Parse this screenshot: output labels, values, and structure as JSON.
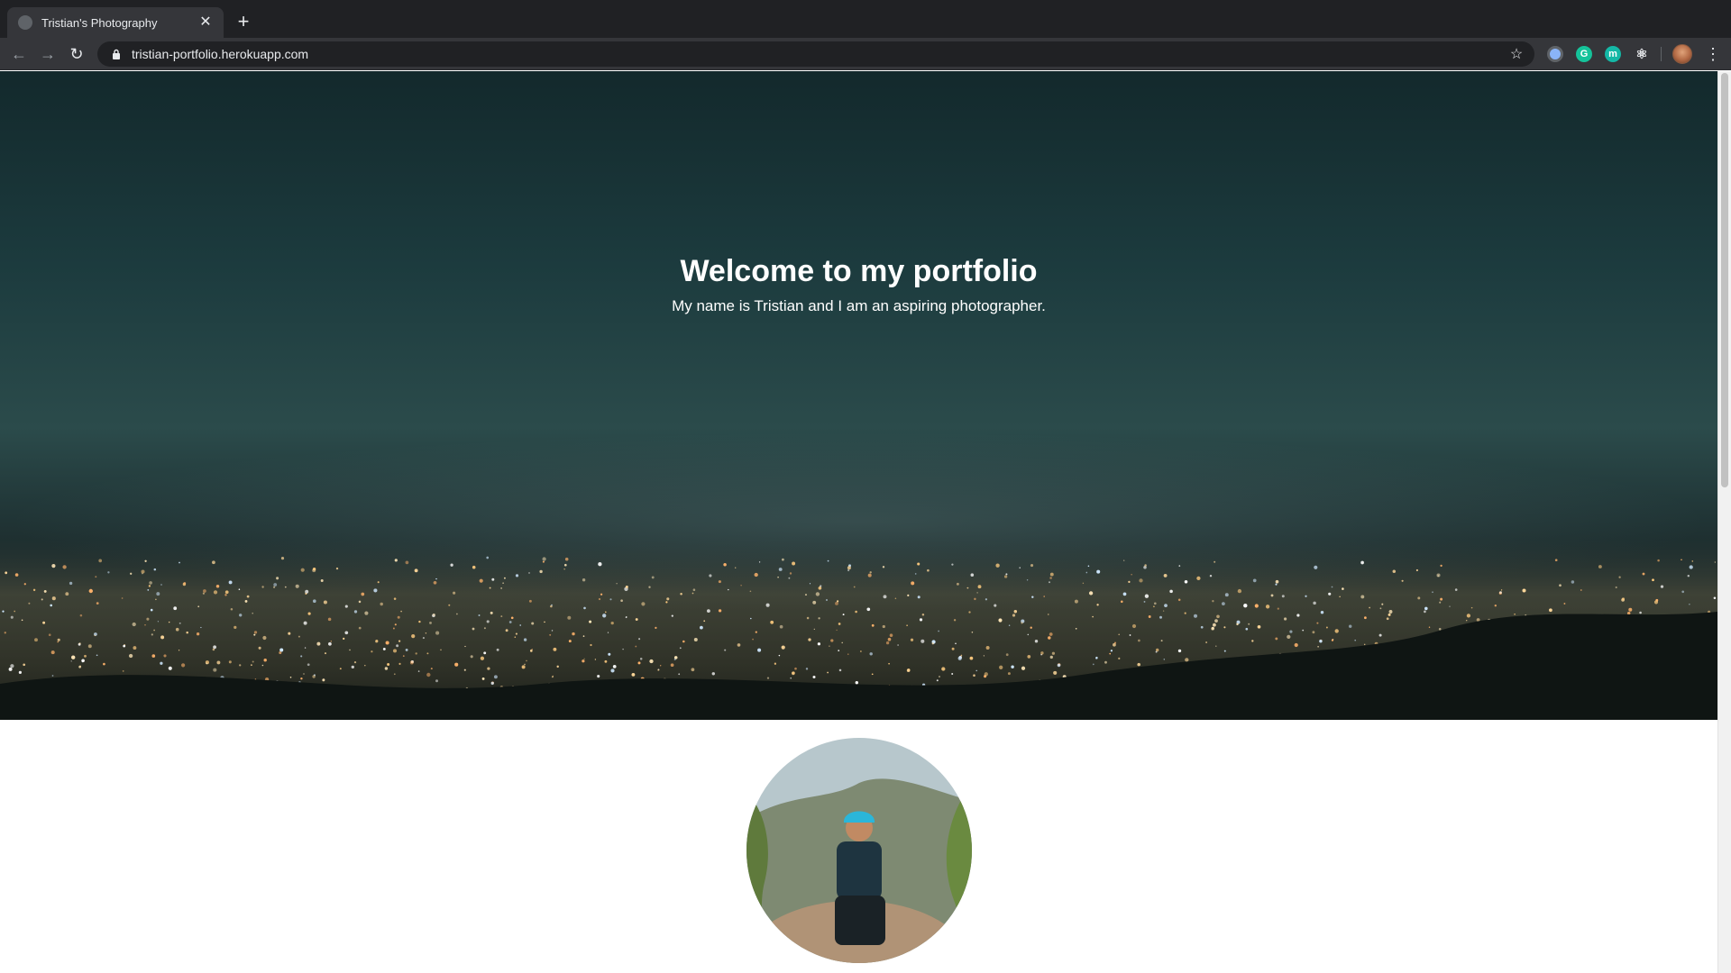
{
  "browser": {
    "tab": {
      "title": "Tristian's Photography",
      "close_glyph": "✕"
    },
    "new_tab_glyph": "+",
    "url": "tristian-portfolio.herokuapp.com",
    "icons": {
      "back": "←",
      "forward": "→",
      "reload": "↻",
      "star": "☆",
      "menu": "⋮",
      "ext_grammarly": "G",
      "ext_m": "m",
      "ext_react": "⚛"
    },
    "extensions": [
      "extension-blue-icon",
      "grammarly-icon",
      "m-extension-icon",
      "react-devtools-icon"
    ]
  },
  "hero": {
    "title": "Welcome to my portfolio",
    "subtitle": "My name is Tristian and I am an aspiring photographer."
  },
  "colors": {
    "chrome_dark": "#202124",
    "chrome_toolbar": "#35363a",
    "hero_sky": "#1c3b3e",
    "text_light": "#ffffff"
  }
}
